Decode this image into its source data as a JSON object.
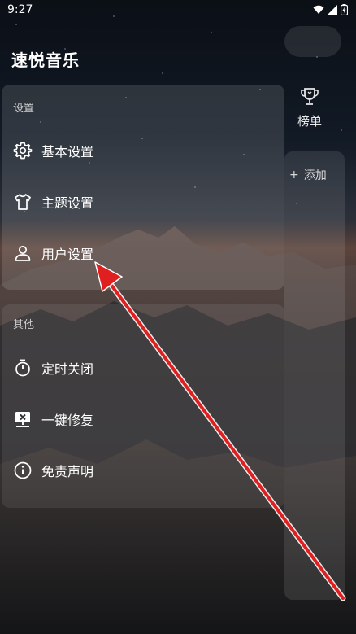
{
  "status_bar": {
    "time": "9:27"
  },
  "app": {
    "title": "速悦音乐"
  },
  "drawer": {
    "settings_section": {
      "header": "设置",
      "items": [
        {
          "label": "基本设置",
          "icon": "gear-icon"
        },
        {
          "label": "主题设置",
          "icon": "tshirt-icon"
        },
        {
          "label": "用户设置",
          "icon": "user-icon"
        }
      ]
    },
    "other_section": {
      "header": "其他",
      "items": [
        {
          "label": "定时关闭",
          "icon": "timer-icon"
        },
        {
          "label": "一键修复",
          "icon": "repair-icon"
        },
        {
          "label": "免责声明",
          "icon": "info-icon"
        }
      ]
    }
  },
  "main": {
    "chart_tab_label": "榜单",
    "add_label": "添加"
  },
  "annotation": {
    "color": "#e02020",
    "target": "用户设置"
  }
}
